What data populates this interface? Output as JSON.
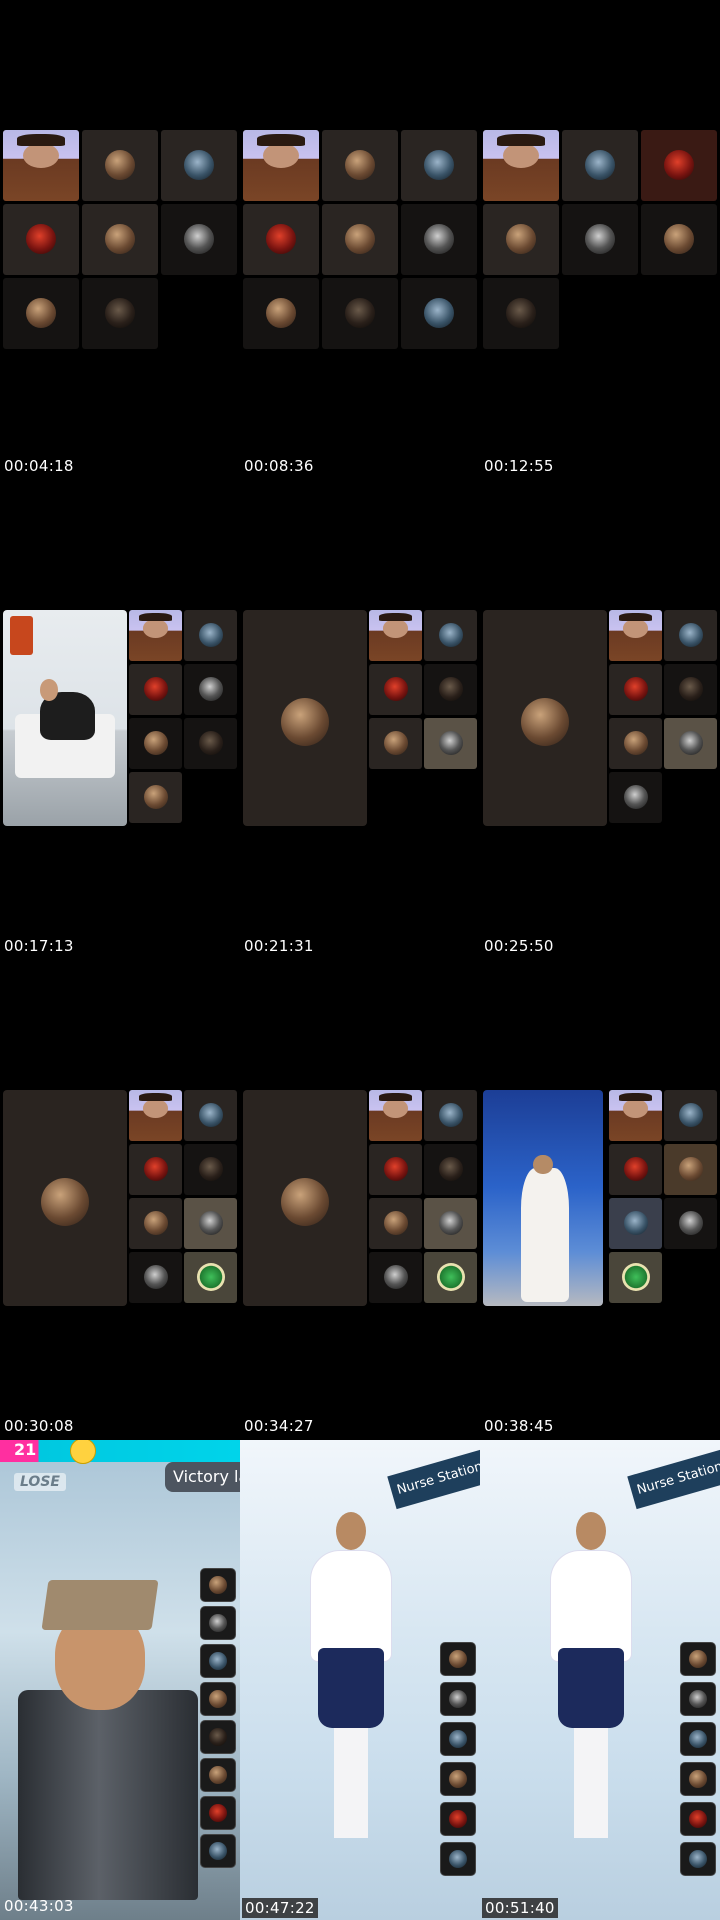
{
  "timestamps": [
    "00:04:18",
    "00:08:36",
    "00:12:55",
    "00:17:13",
    "00:21:31",
    "00:25:50",
    "00:30:08",
    "00:34:27",
    "00:38:45",
    "00:43:03",
    "00:47:22",
    "00:51:40"
  ],
  "game": {
    "score": "21",
    "lose_label": "LOSE",
    "banner": "Victory la"
  },
  "nurse_sign": "Nurse Station",
  "icons": [
    "avatar-icon",
    "emoji-icon"
  ],
  "colors": {
    "hud_pink": "#ff2fa0",
    "hud_cyan": "#00d4ea",
    "nurse_navy": "#1c2a5c"
  }
}
